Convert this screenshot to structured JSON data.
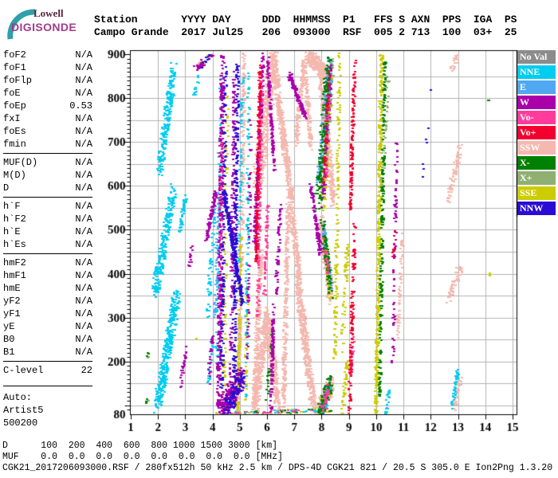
{
  "logo": {
    "top": "Lowell",
    "bottom": "DIGISONDE"
  },
  "header": {
    "line1": "Station       YYYY DAY     DDD  HHMMSS  P1   FFS S AXN  PPS  IGA  PS",
    "line2": "Campo Grande  2017 Jul25   206  093000  RSF  005 2 713  100  03+  25"
  },
  "params": {
    "sections": [
      {
        "rows": [
          [
            "foF2",
            "N/A"
          ],
          [
            "foF1",
            "N/A"
          ],
          [
            "foFlp",
            "N/A"
          ],
          [
            "foE",
            "N/A"
          ],
          [
            "foEp",
            "0.53"
          ],
          [
            "fxI",
            "N/A"
          ],
          [
            "foEs",
            "N/A"
          ],
          [
            "fmin",
            "N/A"
          ]
        ]
      },
      {
        "rows": [
          [
            "MUF(D)",
            "N/A"
          ],
          [
            "M(D)",
            "N/A"
          ],
          [
            "D",
            "N/A"
          ]
        ]
      },
      {
        "rows": [
          [
            "h`F",
            "N/A"
          ],
          [
            "h`F2",
            "N/A"
          ],
          [
            "h`E",
            "N/A"
          ],
          [
            "h`Es",
            "N/A"
          ]
        ]
      },
      {
        "rows": [
          [
            "hmF2",
            "N/A"
          ],
          [
            "hmF1",
            "N/A"
          ],
          [
            "hmE",
            "N/A"
          ],
          [
            "yF2",
            "N/A"
          ],
          [
            "yF1",
            "N/A"
          ],
          [
            "yE",
            "N/A"
          ],
          [
            "B0",
            "N/A"
          ],
          [
            "B1",
            "N/A"
          ]
        ]
      },
      {
        "rows": [
          [
            "C-level",
            "22"
          ]
        ]
      }
    ],
    "footer": [
      "Auto:",
      "Artist5",
      "500200"
    ]
  },
  "legend": {
    "items": [
      {
        "key": "NoVal",
        "label": "No Val",
        "color": "#8c8c8c"
      },
      {
        "key": "NNE",
        "label": "NNE",
        "color": "#00ccf0"
      },
      {
        "key": "E",
        "label": "E",
        "color": "#50a8f0"
      },
      {
        "key": "W",
        "label": "W",
        "color": "#aa00aa"
      },
      {
        "key": "VoM",
        "label": "Vo-",
        "color": "#ff3c9b"
      },
      {
        "key": "VoP",
        "label": "Vo+",
        "color": "#f2002f"
      },
      {
        "key": "SSW",
        "label": "SSW",
        "color": "#f4b8af"
      },
      {
        "key": "Xm",
        "label": "X-",
        "color": "#008000"
      },
      {
        "key": "Xp",
        "label": "X+",
        "color": "#8fb070"
      },
      {
        "key": "SSE",
        "label": "SSE",
        "color": "#cccc00"
      },
      {
        "key": "NNW",
        "label": "NNW",
        "color": "#2a0cd4"
      }
    ]
  },
  "bottom": {
    "d_line": "D      100  200  400  600  800 1000 1500 3000 [km]",
    "muf_line": "MUF    0.0  0.0  0.0  0.0  0.0  0.0  0.0  0.0 [MHz]",
    "status": "CGK21_2017206093000.RSF / 280fx512h 50 kHz 2.5 km / DPS-4D CGK21 821 / 20.5 S 305.0 E Ion2Png 1.3.20"
  },
  "chart_data": {
    "type": "scatter",
    "title": "Digisonde RSF ionogram, Campo Grande, 2017 day 206 09:30:00",
    "xlabel": "[MHz]",
    "ylabel": "[km]",
    "xlim": [
      1,
      15.2
    ],
    "ylim": [
      80,
      909
    ],
    "x_ticks": [
      1,
      2,
      3,
      4,
      5,
      6,
      7,
      8,
      9,
      10,
      11,
      12,
      13,
      14,
      15
    ],
    "y_ticks": [
      900,
      800,
      700,
      600,
      500,
      400,
      300,
      200,
      80
    ],
    "y_minor_step": 10,
    "grid": {
      "x_every": 1,
      "y_every": 50,
      "color": "#b2b2b2"
    },
    "legend_position": "right",
    "draw_order": [
      "SSW",
      "SSE",
      "Xp",
      "E",
      "NNE",
      "Xm",
      "W",
      "VoM",
      "VoP",
      "NNW"
    ],
    "clusters_format": [
      "color_key",
      "f0_MHz",
      "h0_km",
      "f1_MHz",
      "h1_km",
      "f_jitter",
      "h_jitter",
      "n_points"
    ],
    "clusters": [
      [
        "SSW",
        5.48,
        85,
        5.72,
        450,
        0.08,
        14,
        260
      ],
      [
        "SSW",
        5.62,
        620,
        6.25,
        912,
        0.17,
        28,
        420
      ],
      [
        "SSW",
        5.52,
        95,
        5.94,
        305,
        0.1,
        22,
        300
      ],
      [
        "SSW",
        5.94,
        305,
        6.36,
        95,
        0.1,
        22,
        300
      ],
      [
        "SSW",
        6.18,
        895,
        6.75,
        625,
        0.09,
        18,
        330
      ],
      [
        "SSW",
        6.72,
        640,
        7.18,
        355,
        0.09,
        18,
        300
      ],
      [
        "SSW",
        7.1,
        370,
        7.68,
        88,
        0.11,
        18,
        380
      ],
      [
        "SSW",
        6.55,
        88,
        6.74,
        555,
        0.07,
        12,
        280
      ],
      [
        "SSW",
        7.02,
        700,
        7.3,
        882,
        0.06,
        14,
        150
      ],
      [
        "SSW",
        7.32,
        880,
        7.58,
        695,
        0.06,
        14,
        150
      ],
      [
        "SSW",
        7.48,
        898,
        8.12,
        858,
        0.14,
        14,
        280
      ],
      [
        "SSW",
        7.92,
        862,
        8.38,
        565,
        0.09,
        22,
        330
      ],
      [
        "SSW",
        7.82,
        85,
        8.32,
        150,
        0.12,
        20,
        240
      ],
      [
        "SSW",
        7.92,
        525,
        8.3,
        345,
        0.09,
        20,
        220
      ],
      [
        "SSW",
        4.88,
        85,
        4.98,
        335,
        0.05,
        12,
        160
      ],
      [
        "SSW",
        5.02,
        420,
        5.12,
        900,
        0.05,
        12,
        160
      ],
      [
        "SSW",
        10.74,
        255,
        10.92,
        485,
        0.05,
        10,
        65
      ],
      [
        "SSW",
        12.62,
        572,
        13.02,
        685,
        0.08,
        14,
        70
      ],
      [
        "SSW",
        12.58,
        342,
        13.06,
        418,
        0.09,
        12,
        50
      ],
      [
        "SSW",
        12.7,
        862,
        12.96,
        902,
        0.06,
        8,
        22
      ],
      [
        "SSW",
        12.8,
        92,
        13.06,
        172,
        0.06,
        10,
        40
      ],
      [
        "SSW",
        3.42,
        878,
        3.55,
        892,
        0.04,
        5,
        8
      ],
      [
        "SSE",
        4.38,
        95,
        4.5,
        825,
        0.05,
        4,
        80
      ],
      [
        "SSE",
        4.88,
        88,
        5.0,
        500,
        0.04,
        4,
        120
      ],
      [
        "SSE",
        5.14,
        95,
        5.26,
        400,
        0.04,
        4,
        40
      ],
      [
        "SSE",
        8.02,
        560,
        8.32,
        872,
        0.08,
        24,
        100
      ],
      [
        "SSE",
        7.88,
        86,
        8.3,
        148,
        0.08,
        15,
        60
      ],
      [
        "SSE",
        7.98,
        510,
        8.28,
        355,
        0.07,
        15,
        55
      ],
      [
        "SSE",
        8.44,
        205,
        8.62,
        905,
        0.05,
        6,
        140
      ],
      [
        "SSE",
        8.7,
        230,
        8.92,
        480,
        0.06,
        10,
        50
      ],
      [
        "SSE",
        8.72,
        82,
        8.88,
        200,
        0.05,
        10,
        40
      ],
      [
        "SSE",
        9.96,
        82,
        10.16,
        902,
        0.06,
        5,
        400
      ],
      [
        "SSE",
        3.4,
        866,
        3.85,
        898,
        0.06,
        8,
        8
      ],
      [
        "SSE",
        3.36,
        250,
        3.39,
        256,
        0.02,
        3,
        3
      ],
      [
        "SSE",
        14.08,
        393,
        14.13,
        400,
        0.02,
        4,
        3
      ],
      [
        "SSE",
        4.0,
        82,
        8.4,
        92,
        0.05,
        5,
        40
      ],
      [
        "Xp",
        7.96,
        580,
        8.32,
        882,
        0.1,
        28,
        150
      ],
      [
        "Xp",
        10.18,
        590,
        10.38,
        855,
        0.06,
        12,
        45
      ],
      [
        "Xp",
        1.6,
        212,
        1.63,
        216,
        0.02,
        3,
        3
      ],
      [
        "Xp",
        1.57,
        108,
        1.6,
        112,
        0.02,
        3,
        3
      ],
      [
        "E",
        4.05,
        300,
        4.18,
        560,
        0.05,
        5,
        55
      ],
      [
        "E",
        7.86,
        600,
        8.28,
        892,
        0.1,
        28,
        130
      ],
      [
        "E",
        7.95,
        90,
        8.28,
        150,
        0.08,
        15,
        60
      ],
      [
        "E",
        8.02,
        515,
        8.3,
        370,
        0.07,
        15,
        60
      ],
      [
        "NNE",
        2.0,
        630,
        2.55,
        868,
        0.12,
        18,
        200
      ],
      [
        "NNE",
        1.85,
        355,
        2.5,
        590,
        0.12,
        18,
        240
      ],
      [
        "NNE",
        1.95,
        100,
        2.65,
        350,
        0.14,
        18,
        320
      ],
      [
        "NNE",
        2.74,
        495,
        2.96,
        572,
        0.05,
        10,
        45
      ],
      [
        "NNE",
        3.28,
        805,
        3.46,
        852,
        0.05,
        8,
        14
      ],
      [
        "NNE",
        3.78,
        300,
        4.05,
        560,
        0.06,
        12,
        60
      ],
      [
        "NNE",
        3.82,
        155,
        3.96,
        258,
        0.04,
        8,
        24
      ],
      [
        "NNE",
        4.12,
        190,
        4.26,
        862,
        0.05,
        4,
        80
      ],
      [
        "NNE",
        4.92,
        420,
        5.06,
        860,
        0.05,
        4,
        60
      ],
      [
        "NNE",
        5.18,
        120,
        5.3,
        858,
        0.05,
        4,
        90
      ],
      [
        "NNE",
        8.05,
        90,
        8.25,
        145,
        0.05,
        10,
        30
      ],
      [
        "NNE",
        10.3,
        80,
        10.45,
        140,
        0.05,
        8,
        25
      ],
      [
        "NNE",
        12.74,
        98,
        12.96,
        182,
        0.05,
        10,
        50
      ],
      [
        "NNE",
        4.1,
        82,
        8.3,
        92,
        0.05,
        4,
        30
      ],
      [
        "Xm",
        5.92,
        110,
        6.18,
        260,
        0.06,
        20,
        30
      ],
      [
        "Xm",
        7.82,
        560,
        8.24,
        900,
        0.11,
        28,
        170
      ],
      [
        "Xm",
        7.9,
        88,
        8.3,
        155,
        0.1,
        18,
        90
      ],
      [
        "Xm",
        8.0,
        520,
        8.3,
        360,
        0.08,
        18,
        80
      ],
      [
        "Xm",
        10.08,
        120,
        10.28,
        892,
        0.05,
        5,
        210
      ],
      [
        "Xm",
        1.57,
        215,
        1.6,
        220,
        0.02,
        4,
        4
      ],
      [
        "Xm",
        1.53,
        110,
        1.57,
        116,
        0.02,
        4,
        4
      ],
      [
        "Xm",
        14.08,
        795,
        14.13,
        802,
        0.02,
        4,
        3
      ],
      [
        "Xm",
        4.5,
        82,
        8.35,
        92,
        0.05,
        4,
        25
      ],
      [
        "W",
        4.18,
        85,
        4.33,
        898,
        0.07,
        4,
        360
      ],
      [
        "W",
        4.62,
        120,
        4.76,
        860,
        0.05,
        4,
        150
      ],
      [
        "W",
        4.25,
        88,
        5.05,
        170,
        0.18,
        22,
        220
      ],
      [
        "W",
        5.24,
        200,
        5.36,
        750,
        0.05,
        4,
        60
      ],
      [
        "W",
        5.5,
        470,
        5.82,
        898,
        0.05,
        8,
        240
      ],
      [
        "W",
        5.97,
        896,
        6.22,
        640,
        0.04,
        8,
        140
      ],
      [
        "W",
        6.1,
        85,
        6.2,
        330,
        0.04,
        8,
        130
      ],
      [
        "W",
        6.28,
        350,
        6.45,
        560,
        0.05,
        8,
        60
      ],
      [
        "W",
        6.76,
        858,
        7.36,
        762,
        0.05,
        9,
        120
      ],
      [
        "W",
        7.55,
        608,
        7.92,
        448,
        0.05,
        9,
        110
      ],
      [
        "W",
        8.0,
        560,
        8.3,
        880,
        0.07,
        20,
        60
      ],
      [
        "W",
        2.8,
        150,
        3.0,
        238,
        0.04,
        8,
        26
      ],
      [
        "W",
        3.1,
        420,
        3.22,
        465,
        0.04,
        8,
        14
      ],
      [
        "W",
        3.8,
        150,
        3.95,
        262,
        0.05,
        10,
        30
      ],
      [
        "W",
        3.72,
        480,
        4.08,
        585,
        0.05,
        10,
        70
      ],
      [
        "W",
        3.35,
        868,
        3.95,
        900,
        0.1,
        8,
        22
      ],
      [
        "W",
        10.54,
        145,
        10.72,
        705,
        0.05,
        7,
        75
      ],
      [
        "VoM",
        4.22,
        300,
        4.32,
        700,
        0.04,
        4,
        40
      ],
      [
        "VoM",
        5.62,
        300,
        5.76,
        858,
        0.04,
        6,
        150
      ],
      [
        "VoM",
        5.86,
        350,
        5.98,
        560,
        0.04,
        6,
        60
      ],
      [
        "VoM",
        8.1,
        620,
        8.25,
        800,
        0.05,
        15,
        30
      ],
      [
        "VoM",
        8.0,
        95,
        8.2,
        140,
        0.06,
        12,
        35
      ],
      [
        "VoM",
        8.05,
        480,
        8.2,
        400,
        0.05,
        12,
        25
      ],
      [
        "VoM",
        9.02,
        180,
        9.12,
        260,
        0.04,
        8,
        25
      ],
      [
        "VoM",
        4.3,
        83,
        8.2,
        91,
        0.05,
        4,
        25
      ],
      [
        "VoP",
        5.56,
        430,
        5.7,
        872,
        0.04,
        6,
        200
      ],
      [
        "VoP",
        8.04,
        600,
        8.22,
        850,
        0.05,
        18,
        55
      ],
      [
        "VoP",
        8.98,
        85,
        9.18,
        515,
        0.05,
        8,
        130
      ],
      [
        "VoP",
        9.0,
        545,
        9.18,
        888,
        0.04,
        6,
        130
      ],
      [
        "VoP",
        10.58,
        440,
        10.64,
        500,
        0.03,
        6,
        8
      ],
      [
        "NNW",
        4.3,
        140,
        4.43,
        872,
        0.05,
        4,
        130
      ],
      [
        "NNW",
        4.74,
        88,
        4.88,
        880,
        0.06,
        4,
        240
      ],
      [
        "NNW",
        4.38,
        592,
        5.06,
        332,
        0.05,
        8,
        220
      ],
      [
        "NNW",
        4.45,
        92,
        5.02,
        168,
        0.14,
        18,
        90
      ],
      [
        "NNW",
        3.5,
        870,
        3.9,
        902,
        0.08,
        8,
        10
      ],
      [
        "NNW",
        11.68,
        608,
        11.95,
        843,
        0.06,
        8,
        7
      ]
    ]
  }
}
